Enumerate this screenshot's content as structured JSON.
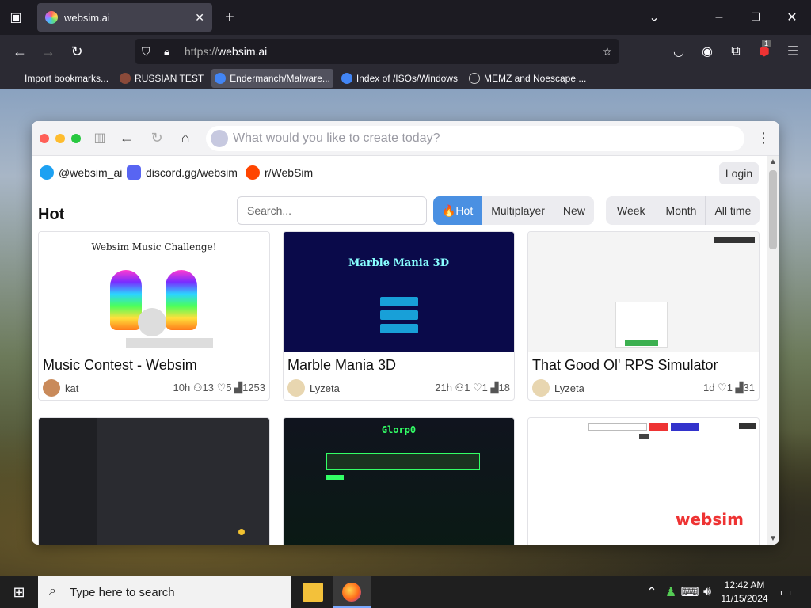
{
  "browser": {
    "tab_title": "websim.ai",
    "url_proto": "https://",
    "url_host": "websim.ai",
    "extension_badge": "1",
    "bookmarks": [
      {
        "label": "Import bookmarks...",
        "color": "#cccccc"
      },
      {
        "label": "RUSSIAN TEST",
        "color": "#8a4a3a"
      },
      {
        "label": "Endermanch/Malware...",
        "color": "#4285f4"
      },
      {
        "label": "Index of /ISOs/Windows",
        "color": "#4285f4"
      },
      {
        "label": "MEMZ and Noescape ...",
        "color": "#aaaaaa"
      }
    ]
  },
  "app": {
    "prompt_placeholder": "What would you like to create today?",
    "social": [
      {
        "label": "@websim_ai",
        "color": "#1da1f2"
      },
      {
        "label": "discord.gg/websim",
        "color": "#5865f2"
      },
      {
        "label": "r/WebSim",
        "color": "#ff4500"
      }
    ],
    "login_label": "Login",
    "section_title": "Hot",
    "search_placeholder": "Search...",
    "sort_tabs": [
      "🔥Hot",
      "Multiplayer",
      "New"
    ],
    "time_tabs": [
      "Week",
      "Month",
      "All time"
    ],
    "cards": [
      {
        "title": "Music Contest - Websim",
        "author": "kat",
        "stats": "10h ⚇13 ♡5 ▟1253",
        "thumb_text": "Websim Music Challenge!"
      },
      {
        "title": "Marble Mania 3D",
        "author": "Lyzeta",
        "stats": "21h ⚇1 ♡1 ▟18",
        "thumb_text": "Marble Mania 3D"
      },
      {
        "title": "That Good Ol' RPS Simulator",
        "author": "Lyzeta",
        "stats": "1d ♡1 ▟31",
        "thumb_text": ""
      },
      {
        "title": "",
        "author": "",
        "stats": "",
        "thumb_text": ""
      },
      {
        "title": "",
        "author": "",
        "stats": "",
        "thumb_text": "Glorp0"
      },
      {
        "title": "",
        "author": "",
        "stats": "",
        "thumb_text": "websim"
      }
    ]
  },
  "taskbar": {
    "search_placeholder": "Type here to search",
    "time": "12:42 AM",
    "date": "11/15/2024"
  }
}
